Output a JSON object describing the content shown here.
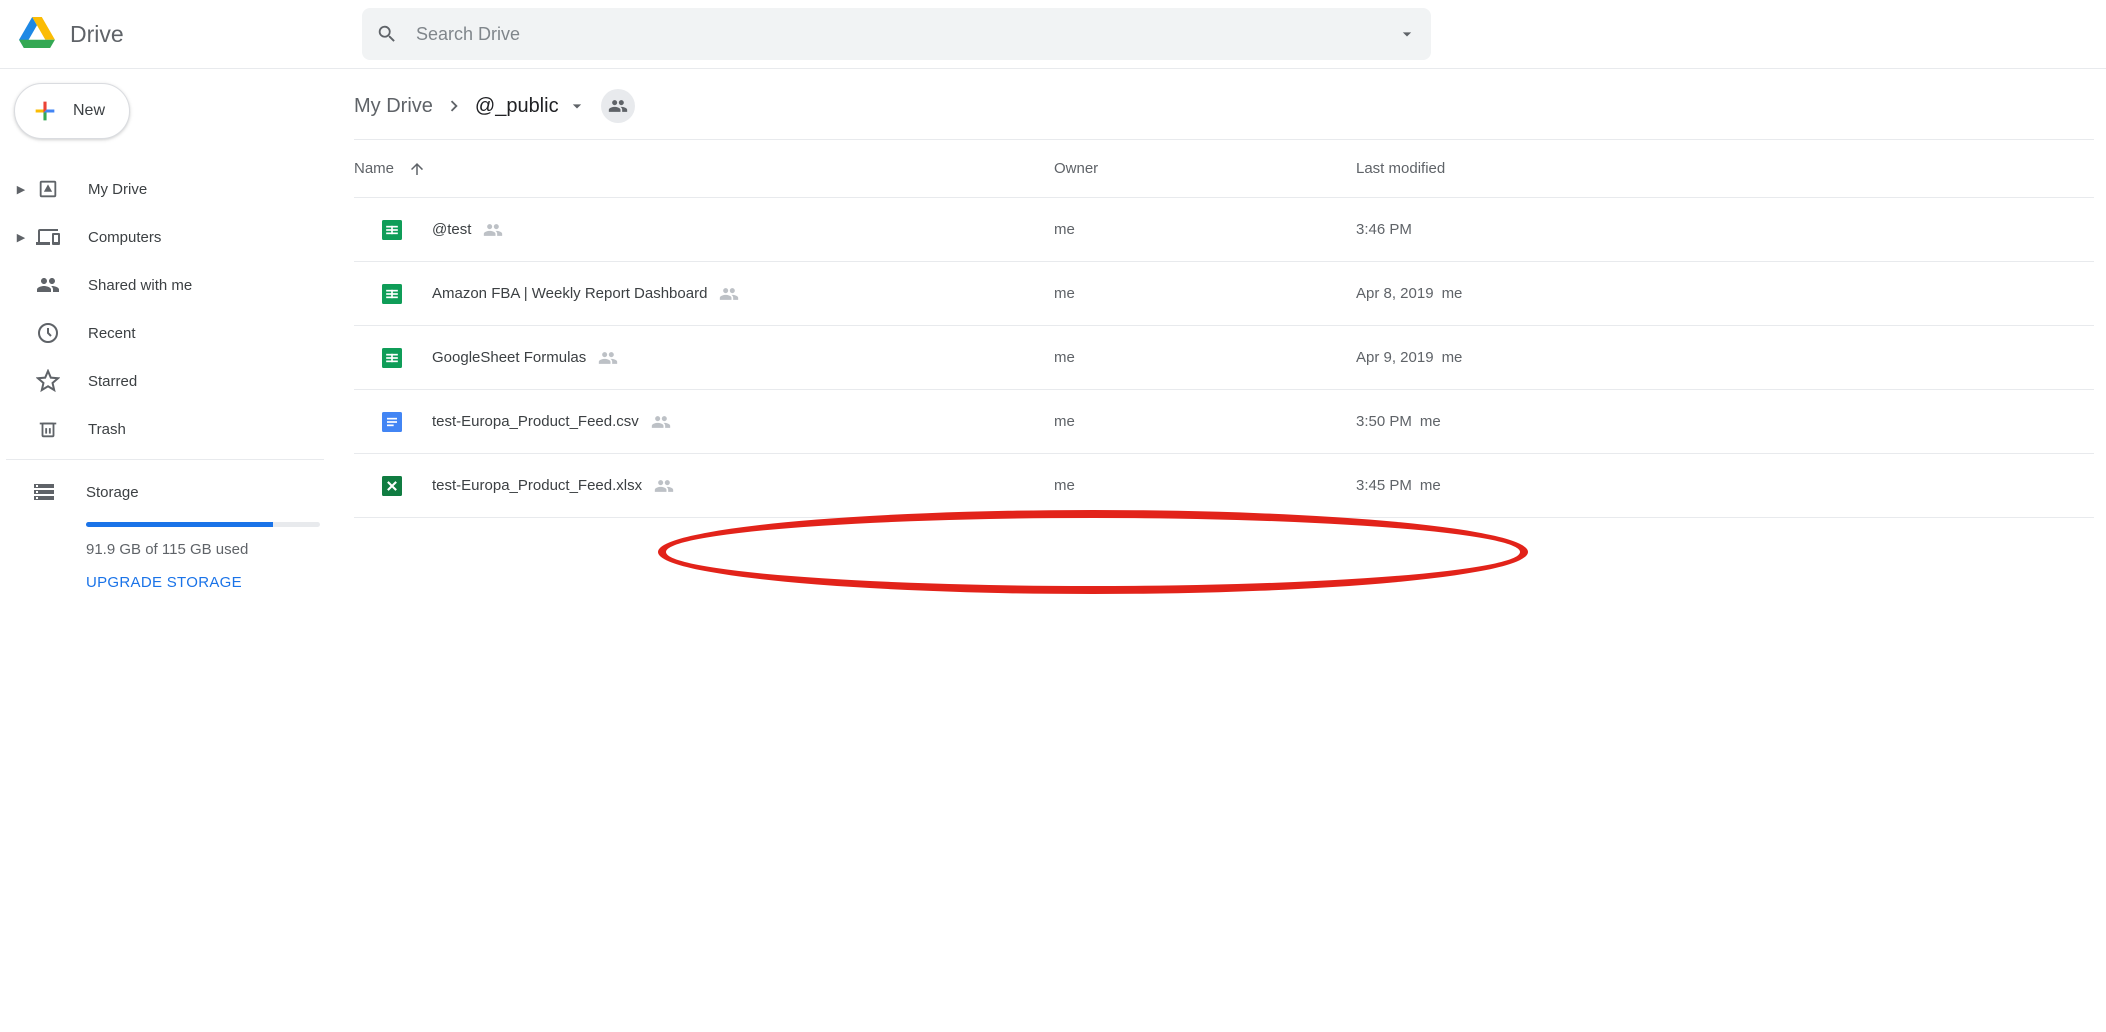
{
  "header": {
    "app_name": "Drive",
    "search_placeholder": "Search Drive"
  },
  "sidebar": {
    "new_label": "New",
    "items": [
      {
        "label": "My Drive",
        "icon": "drive-icon",
        "expandable": true
      },
      {
        "label": "Computers",
        "icon": "computers-icon",
        "expandable": true
      },
      {
        "label": "Shared with me",
        "icon": "shared-icon",
        "expandable": false
      },
      {
        "label": "Recent",
        "icon": "recent-icon",
        "expandable": false
      },
      {
        "label": "Starred",
        "icon": "star-icon",
        "expandable": false
      },
      {
        "label": "Trash",
        "icon": "trash-icon",
        "expandable": false
      }
    ],
    "storage": {
      "label": "Storage",
      "used_text": "91.9 GB of 115 GB used",
      "upgrade_label": "UPGRADE STORAGE",
      "fill_percent": 80
    }
  },
  "breadcrumb": {
    "root": "My Drive",
    "current": "@_public"
  },
  "table": {
    "headers": {
      "name": "Name",
      "owner": "Owner",
      "modified": "Last modified"
    },
    "rows": [
      {
        "icon": "sheets",
        "name": "@test",
        "shared": true,
        "owner": "me",
        "modified": "3:46 PM",
        "modified_sub": ""
      },
      {
        "icon": "sheets",
        "name": "Amazon FBA | Weekly Report Dashboard",
        "shared": true,
        "owner": "me",
        "modified": "Apr 8, 2019",
        "modified_sub": "me"
      },
      {
        "icon": "sheets",
        "name": "GoogleSheet Formulas",
        "shared": true,
        "owner": "me",
        "modified": "Apr 9, 2019",
        "modified_sub": "me"
      },
      {
        "icon": "docs",
        "name": "test-Europa_Product_Feed.csv",
        "shared": true,
        "owner": "me",
        "modified": "3:50 PM",
        "modified_sub": "me"
      },
      {
        "icon": "excel",
        "name": "test-Europa_Product_Feed.xlsx",
        "shared": true,
        "owner": "me",
        "modified": "3:45 PM",
        "modified_sub": "me"
      }
    ],
    "highlight_row_index": 3
  }
}
